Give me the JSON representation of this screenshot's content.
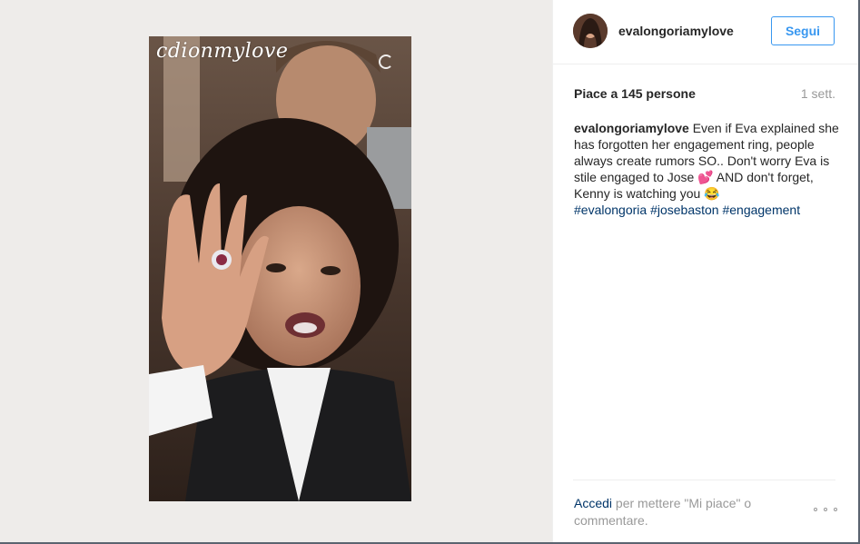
{
  "photo": {
    "watermark": "cdionmylove"
  },
  "header": {
    "username": "evalongoriamylove",
    "follow_label": "Segui"
  },
  "stats": {
    "likes": "Piace a 145 persone",
    "time": "1 sett."
  },
  "caption": {
    "user": "evalongoriamylove",
    "text": " Even if Eva explained she has forgotten her engagement ring, people always create rumors SO.. Don't worry Eva is stile engaged to Jose 💕 AND don't forget, Kenny is watching you 😂",
    "hashtags": [
      "#evalongoria",
      "#josebaston",
      "#engagement"
    ]
  },
  "footer": {
    "login_link": "Accedi",
    "login_text": " per mettere \"Mi piace\" o commentare."
  }
}
